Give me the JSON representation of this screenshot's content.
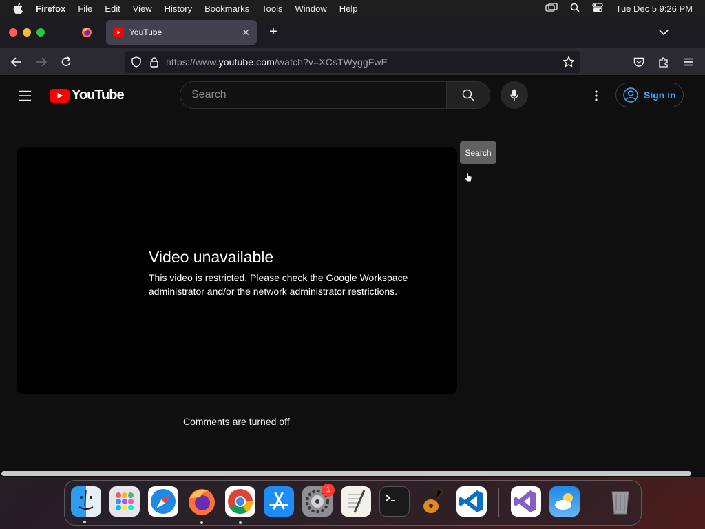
{
  "menubar": {
    "app_name": "Firefox",
    "items": [
      "File",
      "Edit",
      "View",
      "History",
      "Bookmarks",
      "Tools",
      "Window",
      "Help"
    ],
    "clock": "Tue Dec 5  9:26 PM"
  },
  "browser": {
    "active_tab_title": "YouTube",
    "url_prefix": "https://www.",
    "url_domain": "youtube.com",
    "url_path": "/watch?v=XCsTWyggFwE"
  },
  "youtube": {
    "logo_text": "YouTube",
    "search_placeholder": "Search",
    "sign_in_label": "Sign in",
    "tooltip": "Search",
    "player": {
      "title": "Video unavailable",
      "message": "This video is restricted. Please check the Google Workspace administrator and/or the network administrator restrictions."
    },
    "comments_status": "Comments are turned off"
  },
  "dock": {
    "apps": [
      "finder",
      "launchpad",
      "safari",
      "firefox",
      "chrome",
      "app-store",
      "system-settings",
      "textedit",
      "terminal",
      "garageband",
      "vscode",
      "visual-studio",
      "weather",
      "trash"
    ],
    "system_settings_badge": "1"
  },
  "colors": {
    "youtube_red": "#ff0000",
    "link_blue": "#3ea6ff",
    "page_bg": "#0f0f0f"
  }
}
